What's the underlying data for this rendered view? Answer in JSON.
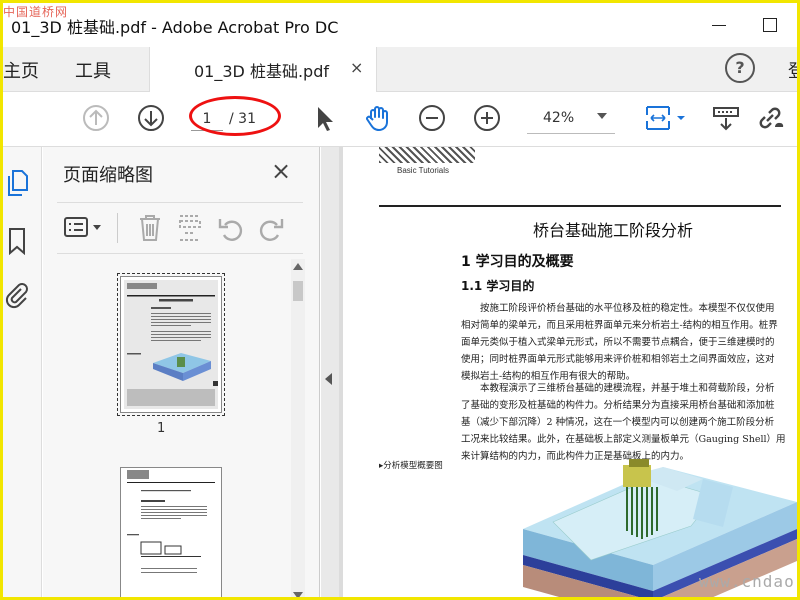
{
  "watermark": "中国道桥网",
  "window": {
    "title": "01_3D 桩基础.pdf - Adobe Acrobat Pro DC"
  },
  "tabs": {
    "home": "主页",
    "tools": "工具",
    "doc": "01_3D 桩基础.pdf",
    "close": "×",
    "help": "?",
    "login": "登"
  },
  "toolbar": {
    "page_current": "1",
    "page_total": "/ 31",
    "zoom": "42%"
  },
  "panel": {
    "title": "页面缩略图",
    "close": "×",
    "thumb_labels": [
      "1"
    ]
  },
  "doc": {
    "header_tag": "Basic Tutorials",
    "title": "桥台基础施工阶段分析",
    "h1": "1 学习目的及概要",
    "h2": "1.1 学习目的",
    "para1": [
      "按施工阶段评价桥台基础的水平位移及桩的稳定性。本模型不仅仅使用",
      "相对简单的梁单元，而且采用桩界面单元来分析岩土-结构的相互作用。桩界",
      "面单元类似于植入式梁单元形式，所以不需要节点耦合，便于三维建模时的",
      "使用；同时桩界面单元形式能够用来评价桩和相邻岩土之间界面效应，这对",
      "模拟岩土-结构的相互作用有很大的帮助。"
    ],
    "para2": [
      "本教程演示了三维桥台基础的建模流程，并基于堆土和荷载阶段，分析",
      "了基础的变形及桩基础的构件力。分析结果分为直接采用桥台基础和添加桩",
      "基（减少下部沉降）2 种情况，这在一个模型内可以创建两个施工阶段分析",
      "工况来比较结果。此外，在基础板上部定义测量板单元（Gauging Shell）用",
      "来计算结构的内力，而此构件力正是基础板上的内力。"
    ],
    "figure_label": "▸分析模型概要图",
    "site_url": "www.cndao.com"
  }
}
